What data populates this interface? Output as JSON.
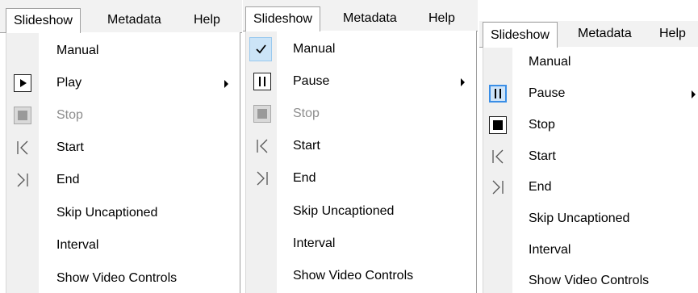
{
  "menubar": {
    "slideshow": "Slideshow",
    "metadata": "Metadata",
    "help": "Help"
  },
  "panel1": {
    "items": [
      {
        "label": "Manual"
      },
      {
        "label": "Play",
        "icon": "play-icon"
      },
      {
        "label": "Stop",
        "icon": "stop-icon",
        "disabled": true
      },
      {
        "label": "Start",
        "icon": "skip-to-start-icon"
      },
      {
        "label": "End",
        "icon": "skip-to-end-icon"
      },
      {
        "label": "Skip Uncaptioned"
      },
      {
        "label": "Interval"
      },
      {
        "label": "Show Video Controls"
      }
    ]
  },
  "panel2": {
    "items": [
      {
        "label": "Manual",
        "checked": true,
        "icon": "checkmark-icon"
      },
      {
        "label": "Pause",
        "icon": "pause-icon"
      },
      {
        "label": "Stop",
        "icon": "stop-icon",
        "disabled": true
      },
      {
        "label": "Start",
        "icon": "skip-to-start-icon"
      },
      {
        "label": "End",
        "icon": "skip-to-end-icon"
      },
      {
        "label": "Skip Uncaptioned"
      },
      {
        "label": "Interval"
      },
      {
        "label": "Show Video Controls"
      }
    ]
  },
  "panel3": {
    "items": [
      {
        "label": "Manual"
      },
      {
        "label": "Pause",
        "icon": "pause-icon"
      },
      {
        "label": "Stop",
        "icon": "stop-icon"
      },
      {
        "label": "Start",
        "icon": "skip-to-start-icon"
      },
      {
        "label": "End",
        "icon": "skip-to-end-icon"
      },
      {
        "label": "Skip Uncaptioned"
      },
      {
        "label": "Interval"
      },
      {
        "label": "Show Video Controls"
      }
    ]
  },
  "colors": {
    "highlight_border": "#3a8ee6",
    "highlight_fill": "#cfe4f8",
    "disabled_text": "#8d8d8d",
    "gutter": "#f0f0f0"
  }
}
